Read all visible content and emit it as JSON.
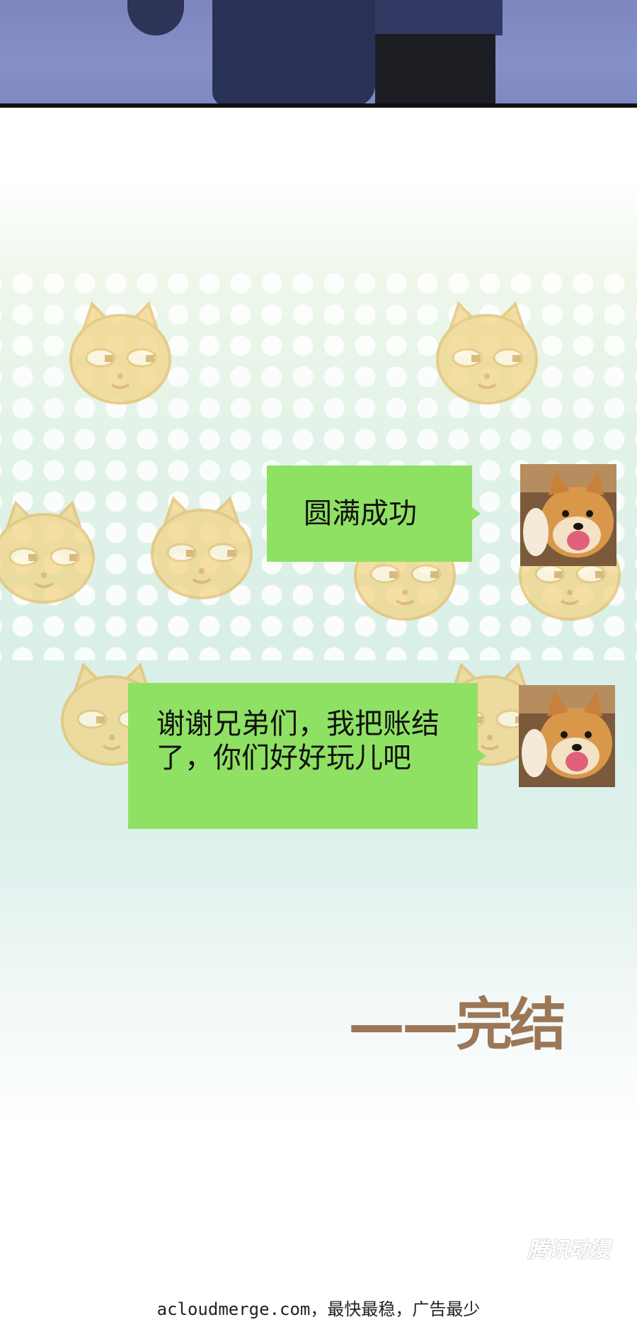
{
  "top_panel": {
    "icon": "characters-bodies-illustration"
  },
  "chat": {
    "messages": [
      {
        "text": "圆满成功",
        "avatar_icon": "shiba-dog-waving-avatar"
      },
      {
        "text": "谢谢兄弟们，我把账结了，你们好好玩儿吧",
        "avatar_icon": "shiba-dog-waving-avatar"
      }
    ],
    "bubble_color": "#8fe163",
    "background_icon": "doge-face-pattern"
  },
  "ending": {
    "label": "——完结",
    "color": "#9b7757"
  },
  "watermark": {
    "logo_text": "腾讯动漫"
  },
  "footer": {
    "text": "acloudmerge.com，最快最稳，广告最少"
  }
}
